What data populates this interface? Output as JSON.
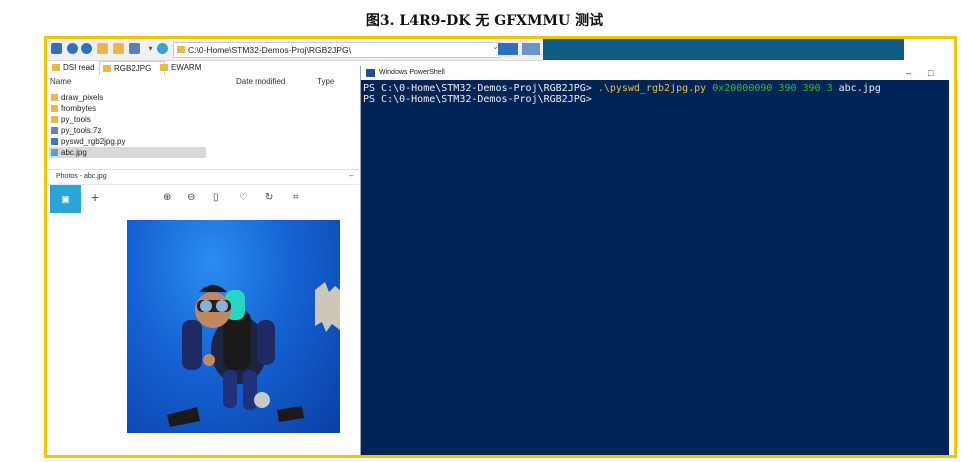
{
  "figure_title": "图3.    L4R9-DK 无 GFXMMU 测试",
  "colors": {
    "frame": "#f4c400",
    "powershell_bg": "#012456",
    "accent": "#2aa5d8"
  },
  "explorer": {
    "address": "C:\\0-Home\\STM32-Demos-Proj\\RGB2JPG\\",
    "tabs": [
      "DSI read",
      "RGB2JPG",
      "EWARM"
    ],
    "columns": [
      "Name",
      "Date modified",
      "Type"
    ],
    "files": [
      "draw_pixels",
      "frombytes",
      "py_tools",
      "py_tools.7z",
      "pyswd_rgb2jpg.py",
      "abc.jpg"
    ],
    "selected_file": "abc.jpg"
  },
  "photos": {
    "title": "Photos - abc.jpg",
    "add_glyph": "+",
    "tools": [
      "zoom-in-icon",
      "zoom-out-icon",
      "delete-icon",
      "heart-icon",
      "rotate-icon",
      "crop-icon"
    ]
  },
  "powershell": {
    "title": "Windows PowerShell",
    "min": "–",
    "max": "□",
    "line1_prompt": "PS C:\\0-Home\\STM32-Demos-Proj\\RGB2JPG> ",
    "line1_cmd": ".\\pyswd_rgb2jpg.py",
    "line1_num": " 0x20000090 390 390 3",
    "line1_arg": " abc.jpg",
    "line2_prompt": "PS C:\\0-Home\\STM32-Demos-Proj\\RGB2JPG>"
  }
}
